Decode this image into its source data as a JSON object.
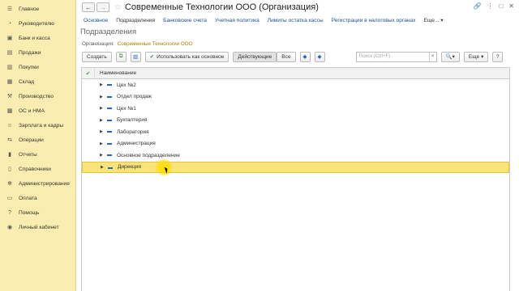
{
  "sidebar": {
    "items": [
      {
        "label": "Главное",
        "icon": "menu-icon"
      },
      {
        "label": "Руководителю",
        "icon": "chart-icon"
      },
      {
        "label": "Банк и касса",
        "icon": "bank-icon"
      },
      {
        "label": "Продажи",
        "icon": "cart-icon"
      },
      {
        "label": "Покупки",
        "icon": "basket-icon"
      },
      {
        "label": "Склад",
        "icon": "warehouse-icon"
      },
      {
        "label": "Производство",
        "icon": "factory-icon"
      },
      {
        "label": "ОС и НМА",
        "icon": "assets-icon"
      },
      {
        "label": "Зарплата и кадры",
        "icon": "people-icon"
      },
      {
        "label": "Операции",
        "icon": "operations-icon"
      },
      {
        "label": "Отчеты",
        "icon": "reports-icon"
      },
      {
        "label": "Справочники",
        "icon": "book-icon"
      },
      {
        "label": "Администрирование",
        "icon": "gear-icon"
      },
      {
        "label": "Оплата",
        "icon": "payment-icon"
      },
      {
        "label": "Помощь",
        "icon": "help-icon"
      },
      {
        "label": "Личный кабинет",
        "icon": "user-icon"
      }
    ]
  },
  "window": {
    "title": "Современные Технологии ООО (Организация)"
  },
  "tabs": [
    {
      "label": "Основное",
      "active": false
    },
    {
      "label": "Подразделения",
      "active": true
    },
    {
      "label": "Банковские счета",
      "active": false
    },
    {
      "label": "Учетная политика",
      "active": false
    },
    {
      "label": "Лимиты остатка кассы",
      "active": false
    },
    {
      "label": "Регистрации в налоговых органах",
      "active": false
    },
    {
      "label": "Еще...",
      "active": false
    }
  ],
  "page": {
    "title": "Подразделения",
    "org_label": "Организация:",
    "org_value": "Современные Технологии ООО"
  },
  "toolbar": {
    "create": "Создать",
    "use_as_main": "Использовать как основное",
    "active_filter": "Действующие",
    "all_filter": "Все",
    "search_placeholder": "Поиск (Ctrl+F)",
    "more": "Еще"
  },
  "table": {
    "header": "Наименование",
    "rows": [
      {
        "name": "Цех №2",
        "selected": false
      },
      {
        "name": "Отдел продаж",
        "selected": false
      },
      {
        "name": "Цех №1",
        "selected": false
      },
      {
        "name": "Бухгалтерия",
        "selected": false
      },
      {
        "name": "Лаборатория",
        "selected": false
      },
      {
        "name": "Администрация",
        "selected": false
      },
      {
        "name": "Основное подразделение",
        "selected": false
      },
      {
        "name": "Дирекция",
        "selected": true
      }
    ]
  }
}
